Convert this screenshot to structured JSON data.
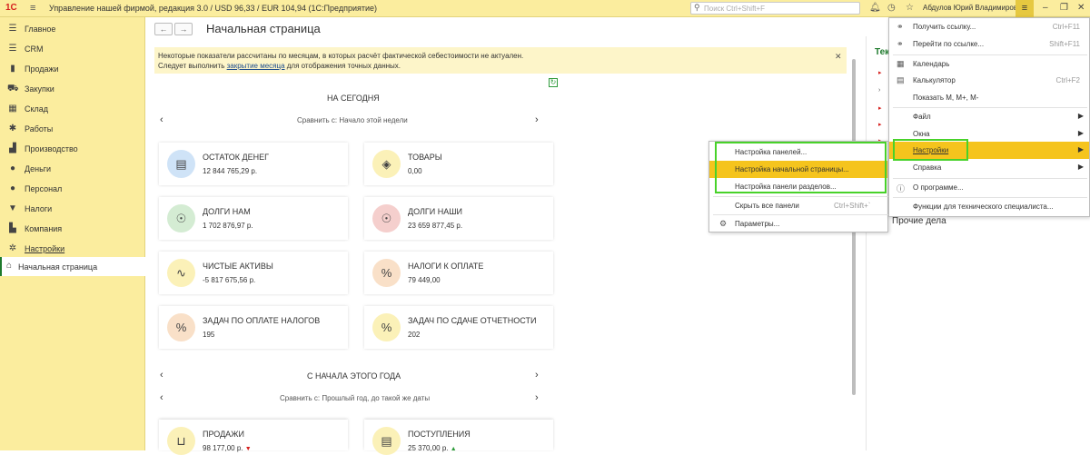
{
  "titlebar": {
    "logo": "1С",
    "app_title": "Управление нашей фирмой, редакция 3.0 / USD 96,33 / EUR 104,94  (1С:Предприятие)",
    "search_placeholder": "Поиск Ctrl+Shift+F",
    "user": "Абдулов Юрий Владимирович"
  },
  "sidebar": {
    "items": [
      {
        "icon": "list-icon",
        "glyph": "☰",
        "label": "Главное"
      },
      {
        "icon": "crm-icon",
        "glyph": "☰",
        "label": "CRM"
      },
      {
        "icon": "sales-icon",
        "glyph": "▮",
        "label": "Продажи"
      },
      {
        "icon": "cart-icon",
        "glyph": "⛟",
        "label": "Закупки"
      },
      {
        "icon": "warehouse-icon",
        "glyph": "▦",
        "label": "Склад"
      },
      {
        "icon": "tools-icon",
        "glyph": "✱",
        "label": "Работы"
      },
      {
        "icon": "factory-icon",
        "glyph": "▟",
        "label": "Производство"
      },
      {
        "icon": "money-icon",
        "glyph": "●",
        "label": "Деньги"
      },
      {
        "icon": "person-icon",
        "glyph": "●",
        "label": "Персонал"
      },
      {
        "icon": "tax-icon",
        "glyph": "▼",
        "label": "Налоги"
      },
      {
        "icon": "company-icon",
        "glyph": "▙",
        "label": "Компания"
      },
      {
        "icon": "gear-icon",
        "glyph": "✲",
        "label": "Настройки"
      }
    ],
    "active": {
      "glyph": "⌂",
      "label": "Начальная страница"
    }
  },
  "main": {
    "page_title": "Начальная страница",
    "warning_line1": "Некоторые показатели рассчитаны по месяцам, в которых расчёт фактической себестоимости не актуален.",
    "warning_line2_pre": "Следует выполнить ",
    "warning_link": "закрытие месяца",
    "warning_line2_post": " для отображения точных данных.",
    "today_title": "НА СЕГОДНЯ",
    "today_compare": "Сравнить с: Начало этой недели",
    "year_title": "С НАЧАЛА ЭТОГО ГОДА",
    "year_compare": "Сравнить с: Прошлый год, до такой же даты",
    "cards": [
      {
        "title": "ОСТАТОК ДЕНЕГ",
        "value": "12 844 765,29 р.",
        "icon": "money-stack-icon",
        "glyph": "▤",
        "color": "#cfe3f7"
      },
      {
        "title": "ТОВАРЫ",
        "value": "0,00",
        "icon": "tag-icon",
        "glyph": "◈",
        "color": "#fbf1b8"
      },
      {
        "title": "ДОЛГИ НАМ",
        "value": "1 702 876,97 р.",
        "icon": "hand-coin-icon",
        "glyph": "☉",
        "color": "#d4ecd3"
      },
      {
        "title": "ДОЛГИ НАШИ",
        "value": "23 659 877,45 р.",
        "icon": "hand-coin-icon",
        "glyph": "☉",
        "color": "#f5cfcd"
      },
      {
        "title": "ЧИСТЫЕ АКТИВЫ",
        "value": "-5 817 675,56 р.",
        "icon": "trend-icon",
        "glyph": "∿",
        "color": "#fbf1b8"
      },
      {
        "title": "НАЛОГИ К ОПЛАТЕ",
        "value": "79 449,00",
        "icon": "percent-icon",
        "glyph": "%",
        "color": "#f9e0c8"
      },
      {
        "title": "ЗАДАЧ ПО ОПЛАТЕ НАЛОГОВ",
        "value": "195",
        "icon": "percent-icon",
        "glyph": "%",
        "color": "#f9e0c8"
      },
      {
        "title": "ЗАДАЧ ПО СДАЧЕ ОТЧЕТНОСТИ",
        "value": "202",
        "icon": "percent-icon",
        "glyph": "%",
        "color": "#fbf1b8"
      },
      {
        "title": "ПРОДАЖИ",
        "value": "98 177,00 р.",
        "icon": "basket-icon",
        "glyph": "⊔",
        "color": "#fbf1b8",
        "trend": "down"
      },
      {
        "title": "ПОСТУПЛЕНИЯ",
        "value": "25 370,00 р.",
        "icon": "money-stack-icon",
        "glyph": "▤",
        "color": "#fbf1b8",
        "trend": "up"
      }
    ]
  },
  "rightcol": {
    "title": "Тек"
  },
  "popup1": {
    "items": [
      {
        "label": "Настройка панелей...",
        "shortcut": ""
      },
      {
        "label": "Настройка начальной страницы...",
        "shortcut": ""
      },
      {
        "label": "Настройка панели разделов...",
        "shortcut": ""
      },
      {
        "label": "Скрыть все панели",
        "shortcut": "Ctrl+Shift+`"
      },
      {
        "label": "Параметры...",
        "shortcut": ""
      }
    ]
  },
  "popup2": {
    "items": [
      {
        "label": "Получить ссылку...",
        "shortcut": "Ctrl+F11",
        "icon": "link-icon",
        "glyph": "⚭"
      },
      {
        "label": "Перейти по ссылке...",
        "shortcut": "Shift+F11",
        "icon": "link-icon",
        "glyph": "⚭"
      },
      {
        "label": "Календарь",
        "shortcut": "",
        "icon": "calendar-icon",
        "glyph": "▦"
      },
      {
        "label": "Калькулятор",
        "shortcut": "Ctrl+F2",
        "icon": "calculator-icon",
        "glyph": "▤"
      },
      {
        "label": "Показать М, М+, М-",
        "shortcut": "",
        "icon": "",
        "glyph": ""
      },
      {
        "label": "Файл",
        "shortcut": "",
        "icon": "",
        "glyph": "",
        "submenu": true
      },
      {
        "label": "Окна",
        "shortcut": "",
        "icon": "",
        "glyph": "",
        "submenu": true
      },
      {
        "label": "Настройки",
        "shortcut": "",
        "icon": "",
        "glyph": "",
        "submenu": true
      },
      {
        "label": "Справка",
        "shortcut": "",
        "icon": "",
        "glyph": "",
        "submenu": true
      },
      {
        "label": "О программе...",
        "shortcut": "",
        "icon": "info-icon",
        "glyph": "ⓘ"
      },
      {
        "label": "Функции для технического специалиста...",
        "shortcut": "",
        "icon": "",
        "glyph": ""
      }
    ]
  },
  "prochie": "Прочие дела",
  "colors": {
    "accent": "#fbed9e",
    "highlight": "#f5c41d",
    "green_frame": "#48d22a"
  }
}
